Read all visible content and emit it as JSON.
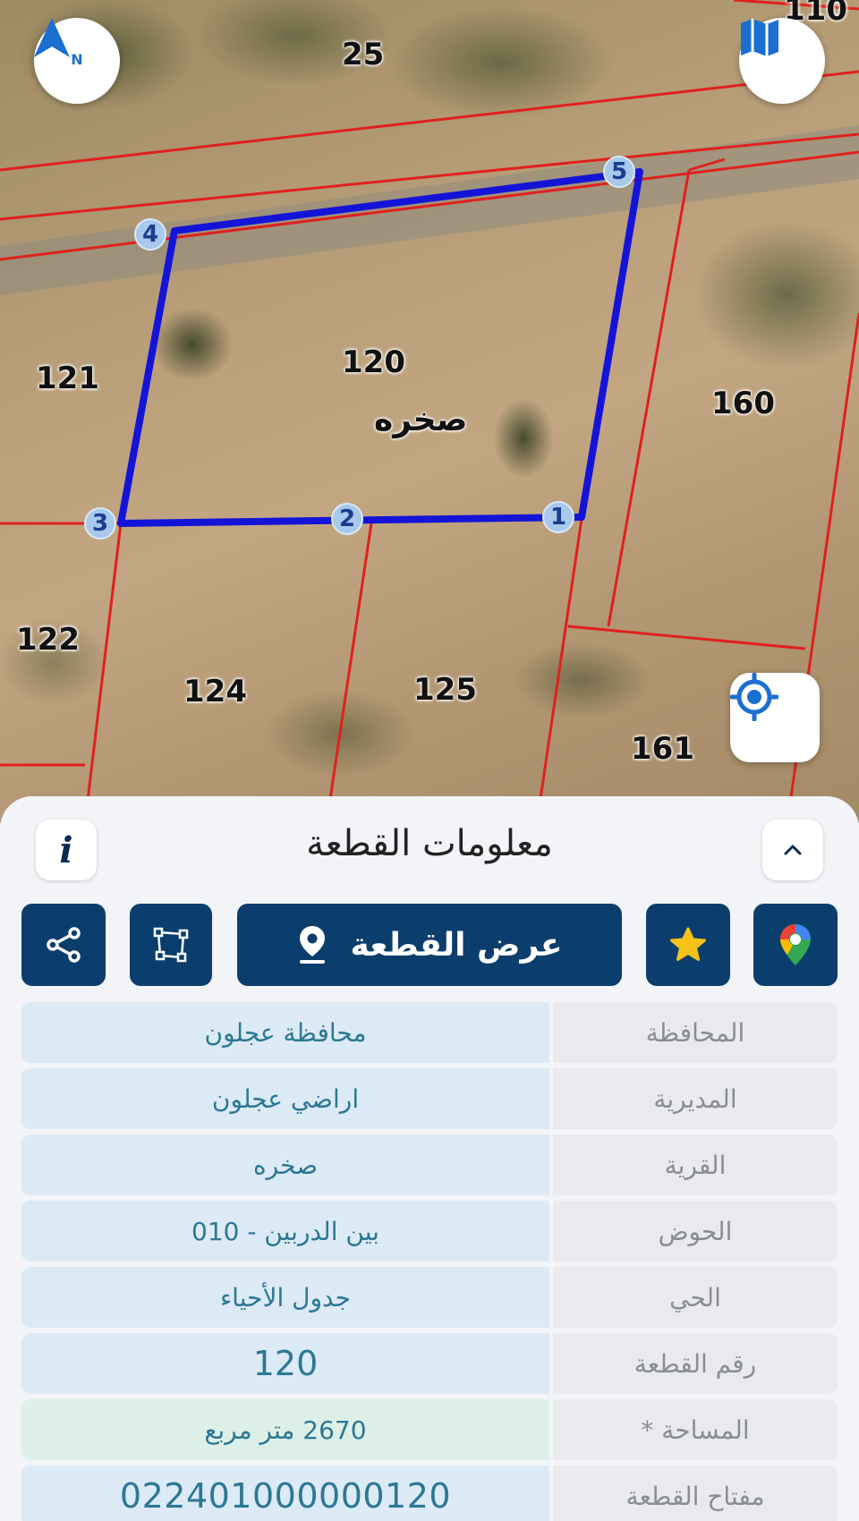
{
  "map": {
    "parcels": [
      {
        "id": "p110",
        "label": "110"
      },
      {
        "id": "p25",
        "label": "25"
      },
      {
        "id": "p120",
        "label": "120"
      },
      {
        "id": "p121",
        "label": "121"
      },
      {
        "id": "p160",
        "label": "160"
      },
      {
        "id": "p122",
        "label": "122"
      },
      {
        "id": "p124",
        "label": "124"
      },
      {
        "id": "p125",
        "label": "125"
      },
      {
        "id": "p161",
        "label": "161"
      }
    ],
    "village_label": "صخره",
    "vertices": [
      "1",
      "2",
      "3",
      "4",
      "5"
    ],
    "north_letter": "N",
    "colors": {
      "boundary": "#1414d8",
      "parcel_lines": "#e0201e",
      "vertex_fill": "#a8c8ec"
    }
  },
  "panel": {
    "title": "معلومات القطعة",
    "info_icon_text": "i",
    "actions": {
      "show_parcel_label": "عرض القطعة"
    },
    "rows": [
      {
        "key": "المحافظة",
        "value": "محافظة عجلون"
      },
      {
        "key": "المديرية",
        "value": "اراضي عجلون"
      },
      {
        "key": "القرية",
        "value": "صخره"
      },
      {
        "key": "الحوض",
        "value": "بين الدربين - 010"
      },
      {
        "key": "الحي",
        "value": "جدول الأحياء"
      },
      {
        "key": "رقم القطعة",
        "value": "120"
      },
      {
        "key": "المساحة *",
        "value": "2670  متر مربع"
      },
      {
        "key": "مفتاح القطعة",
        "value": "022401000000120"
      }
    ],
    "colors": {
      "primary": "#0c3e6d",
      "value_text": "#2c7894",
      "star": "#f4c21a"
    }
  }
}
